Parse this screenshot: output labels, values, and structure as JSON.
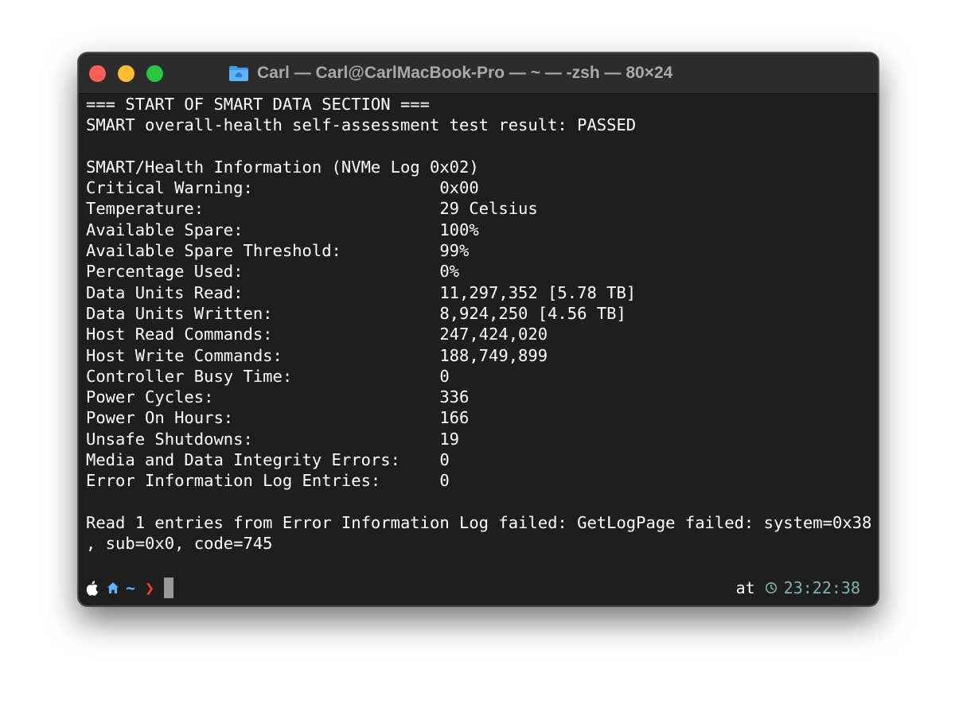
{
  "window": {
    "title": "Carl — Carl@CarlMacBook-Pro — ~ — -zsh — 80×24"
  },
  "terminal": {
    "lines": [
      "=== START OF SMART DATA SECTION ===",
      "SMART overall-health self-assessment test result: PASSED",
      "",
      "SMART/Health Information (NVMe Log 0x02)",
      "Critical Warning:                   0x00",
      "Temperature:                        29 Celsius",
      "Available Spare:                    100%",
      "Available Spare Threshold:          99%",
      "Percentage Used:                    0%",
      "Data Units Read:                    11,297,352 [5.78 TB]",
      "Data Units Written:                 8,924,250 [4.56 TB]",
      "Host Read Commands:                 247,424,020",
      "Host Write Commands:                188,749,899",
      "Controller Busy Time:               0",
      "Power Cycles:                       336",
      "Power On Hours:                     166",
      "Unsafe Shutdowns:                   19",
      "Media and Data Integrity Errors:    0",
      "Error Information Log Entries:      0",
      "",
      "Read 1 entries from Error Information Log failed: GetLogPage failed: system=0x38",
      ", sub=0x0, code=745"
    ]
  },
  "prompt": {
    "dir": "~",
    "symbol": "❯",
    "right_label": "at",
    "time": "23:22:38",
    "colors": {
      "dir": "#5bb6ff",
      "symbol": "#ff3b30",
      "time": "#7fb3b3"
    },
    "icons": [
      "apple-icon",
      "home-icon",
      "clock-icon"
    ]
  }
}
